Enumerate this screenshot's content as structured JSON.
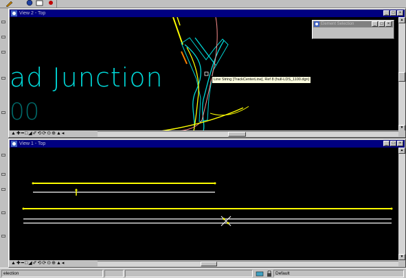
{
  "view2": {
    "title": "View 2 - Top",
    "drawing_text_line1": "ad  Junction",
    "drawing_text_line2": "00",
    "tooltip": "Line String [TrackCenterLine], Ref 8 (hull-LDS_1100.dgn)"
  },
  "element_selection": {
    "title": "Element Selection"
  },
  "view1": {
    "title": "View 1 - Top"
  },
  "window_buttons": {
    "minimize": "_",
    "restore": "□",
    "close": "×"
  },
  "view_controls": "▲✚━□◢✐⟲⟳⊙⊕▲◂",
  "status": {
    "left": "election",
    "level": "Default"
  },
  "colors": {
    "track_yellow": "#ffff00",
    "track_white": "#ffffff",
    "text_cyan": "#00d8d8",
    "title_blue": "#000080"
  },
  "icons": {
    "view_icon": "view-window-icon",
    "lock": "lock-icon",
    "level": "level-icon"
  }
}
